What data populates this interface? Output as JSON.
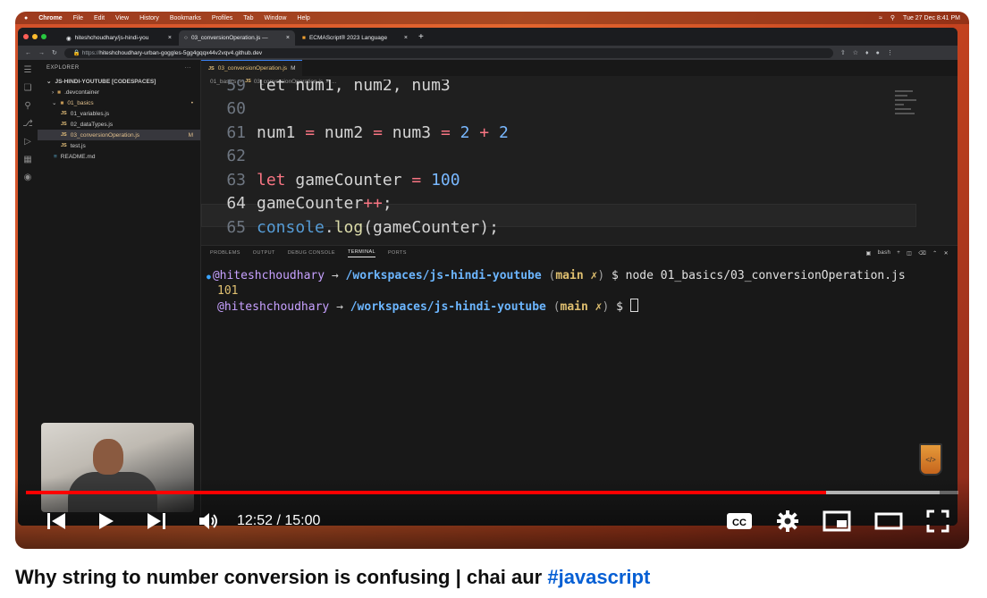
{
  "menubar": {
    "apple": "",
    "app": "Chrome",
    "items": [
      "File",
      "Edit",
      "View",
      "History",
      "Bookmarks",
      "Profiles",
      "Tab",
      "Window",
      "Help"
    ],
    "datetime": "Tue 27 Dec  8:41 PM"
  },
  "browser": {
    "tabs": [
      {
        "label": "hiteshchoudhary/js-hindi-you",
        "close": "×"
      },
      {
        "label": "03_conversionOperation.js —",
        "close": "×"
      },
      {
        "label": "ECMAScript® 2023 Language",
        "close": "×"
      }
    ],
    "new_tab": "+",
    "url_prefix": "https://",
    "url_host": "hiteshchoudhary-urban-goggles-5gg4gqqx44v2vqv4.github.dev"
  },
  "vscode": {
    "explorer_title": "EXPLORER",
    "explorer_more": "···",
    "tree": [
      {
        "label": "JS-HINDI-YOUTUBE [CODESPACES]",
        "kind": "root"
      },
      {
        "label": ".devcontainer",
        "kind": "folder"
      },
      {
        "label": "01_basics",
        "kind": "folder-open"
      },
      {
        "label": "01_variables.js",
        "kind": "js"
      },
      {
        "label": "02_dataTypes.js",
        "kind": "js"
      },
      {
        "label": "03_conversionOperation.js",
        "kind": "js",
        "selected": true,
        "badge": "M"
      },
      {
        "label": "test.js",
        "kind": "js"
      },
      {
        "label": "README.md",
        "kind": "md"
      }
    ],
    "editor_tab": "03_conversionOperation.js",
    "editor_tab_badge": "M",
    "breadcrumb": [
      "01_basics",
      ">",
      "JS",
      "03_conversionOperation.js",
      ">",
      "..."
    ],
    "code_lines": [
      {
        "n": "59",
        "text": "let num1, num2, num3"
      },
      {
        "n": "60",
        "text": ""
      },
      {
        "n": "61",
        "text": "num1 = num2 = num3 = 2 + 2"
      },
      {
        "n": "62",
        "text": ""
      },
      {
        "n": "63",
        "text": "let gameCounter = 100"
      },
      {
        "n": "64",
        "text": "gameCounter++;"
      },
      {
        "n": "65",
        "text": "console.log(gameCounter);"
      }
    ],
    "panel_tabs": [
      "PROBLEMS",
      "OUTPUT",
      "DEBUG CONSOLE",
      "TERMINAL",
      "PORTS"
    ],
    "panel_active": "TERMINAL",
    "panel_shell": "bash",
    "terminal": {
      "user": "@hiteshchoudhary",
      "arrow": "→",
      "path": "/workspaces/js-hindi-youtube",
      "branch": "main",
      "dirty": "✗",
      "command": "$ node 01_basics/03_conversionOperation.js",
      "output": "101",
      "prompt2": "$"
    }
  },
  "player": {
    "current_time": "12:52",
    "duration": "15:00",
    "time_text": "12:52 / 15:00",
    "progress_fraction": 0.858,
    "buffer_fraction": 0.98,
    "progress_color": "#ff0000",
    "icons": [
      "previous-icon",
      "play-icon",
      "next-icon",
      "volume-icon",
      "captions-icon",
      "settings-icon",
      "miniplayer-icon",
      "theater-icon",
      "fullscreen-icon"
    ],
    "cc_label": "CC"
  },
  "video": {
    "title_main": "Why string to number conversion is confusing | chai aur ",
    "title_tag": "#javascript",
    "title_tag_color": "#065fd4"
  }
}
